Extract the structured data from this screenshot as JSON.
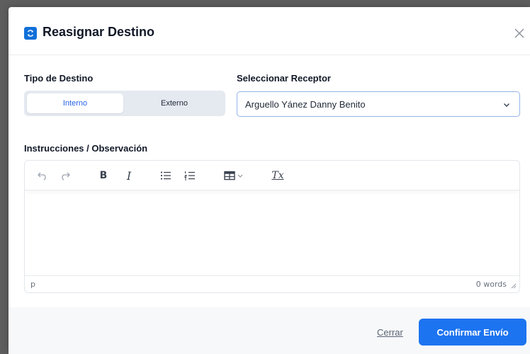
{
  "modal": {
    "title": "Reasignar Destino",
    "close_glyph": "×"
  },
  "tipo_destino": {
    "label": "Tipo de Destino",
    "options": [
      {
        "label": "Interno",
        "selected": true
      },
      {
        "label": "Externo",
        "selected": false
      }
    ]
  },
  "receptor": {
    "label": "Seleccionar Receptor",
    "value": "Arguello Yánez Danny Benito"
  },
  "instrucciones": {
    "label": "Instrucciones / Observación",
    "content": "",
    "path": "p",
    "word_count": "0 words"
  },
  "toolbar": {
    "bold": "B",
    "italic": "I",
    "clear_format": "Tx"
  },
  "footer": {
    "cancel_label": "Cerrar",
    "confirm_label": "Confirmar Envío"
  },
  "colors": {
    "accent": "#1d74f0",
    "icon_bg": "#1170d8",
    "active_tab_text": "#2563eb"
  },
  "icons": [
    "refresh-icon",
    "close-icon",
    "chevron-down-icon",
    "undo-icon",
    "redo-icon",
    "bold-icon",
    "italic-icon",
    "bullet-list-icon",
    "numbered-list-icon",
    "table-icon",
    "clear-format-icon",
    "resize-handle-icon"
  ]
}
